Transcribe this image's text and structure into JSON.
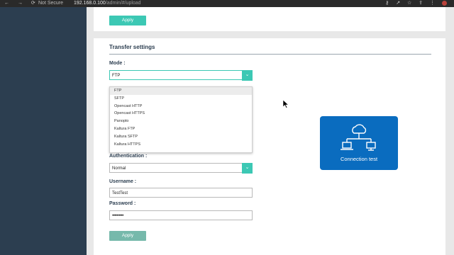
{
  "browser": {
    "nav_icons": "← → ⟳",
    "security": "Not Secure",
    "url_host": "192.168.0.100",
    "url_path": "/admin/#/upload",
    "right_icons": "⚷ ↗ ☆ ⇪ ⋮"
  },
  "top_card": {
    "apply_label": "Apply"
  },
  "transfer": {
    "title": "Transfer settings",
    "mode_label": "Mode :",
    "mode_value": "FTP",
    "mode_options": [
      "FTP",
      "SFTP",
      "Opencast HTTP",
      "Opencast HTTPS",
      "Panopto",
      "Kaltura FTP",
      "Kaltura SFTP",
      "Kaltura HTTPS"
    ],
    "hidden_field_partial": "match",
    "auth_label": "Authentication :",
    "auth_value": "Normal",
    "username_label": "Username :",
    "username_value": "TestTest",
    "password_label": "Password :",
    "password_value": "••••••••••",
    "apply_label": "Apply"
  },
  "connection_test": {
    "label": "Connection test",
    "icon": "cloud-network-icon"
  },
  "colors": {
    "accent": "#3cc8b4",
    "sidebar": "#2c3e50",
    "connection_card": "#0a6cbf"
  }
}
